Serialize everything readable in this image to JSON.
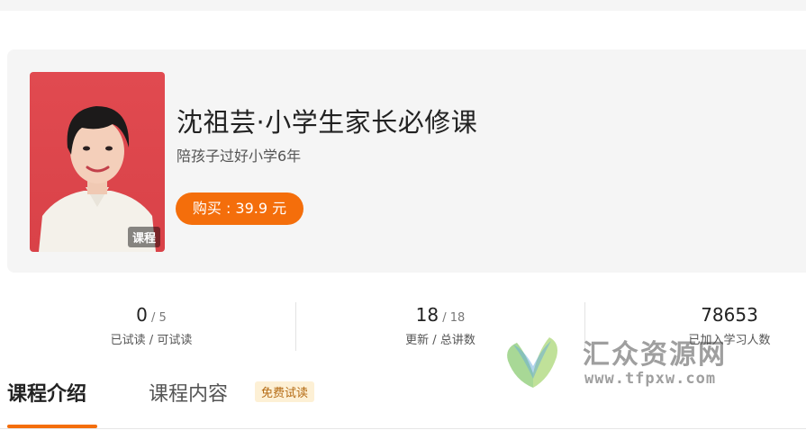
{
  "course": {
    "title": "沈祖芸·小学生家长必修课",
    "subtitle": "陪孩子过好小学6年",
    "cover_badge": "课程",
    "buy_label": "购买 : 39.9 元"
  },
  "stats": [
    {
      "value": "0",
      "total": "5",
      "label": "已试读 / 可试读"
    },
    {
      "value": "18",
      "total": "18",
      "label": "更新 / 总讲数"
    },
    {
      "value": "78653",
      "label": "已加入学习人数"
    }
  ],
  "stats_separator": " / ",
  "tabs": {
    "intro": "课程介绍",
    "content": "课程内容",
    "free_badge": "免费试读"
  },
  "watermark": {
    "name": "汇众资源网",
    "url": "www.tfpxw.com"
  },
  "colors": {
    "accent": "#f46e0b",
    "cover_bg": "#e14a50"
  }
}
